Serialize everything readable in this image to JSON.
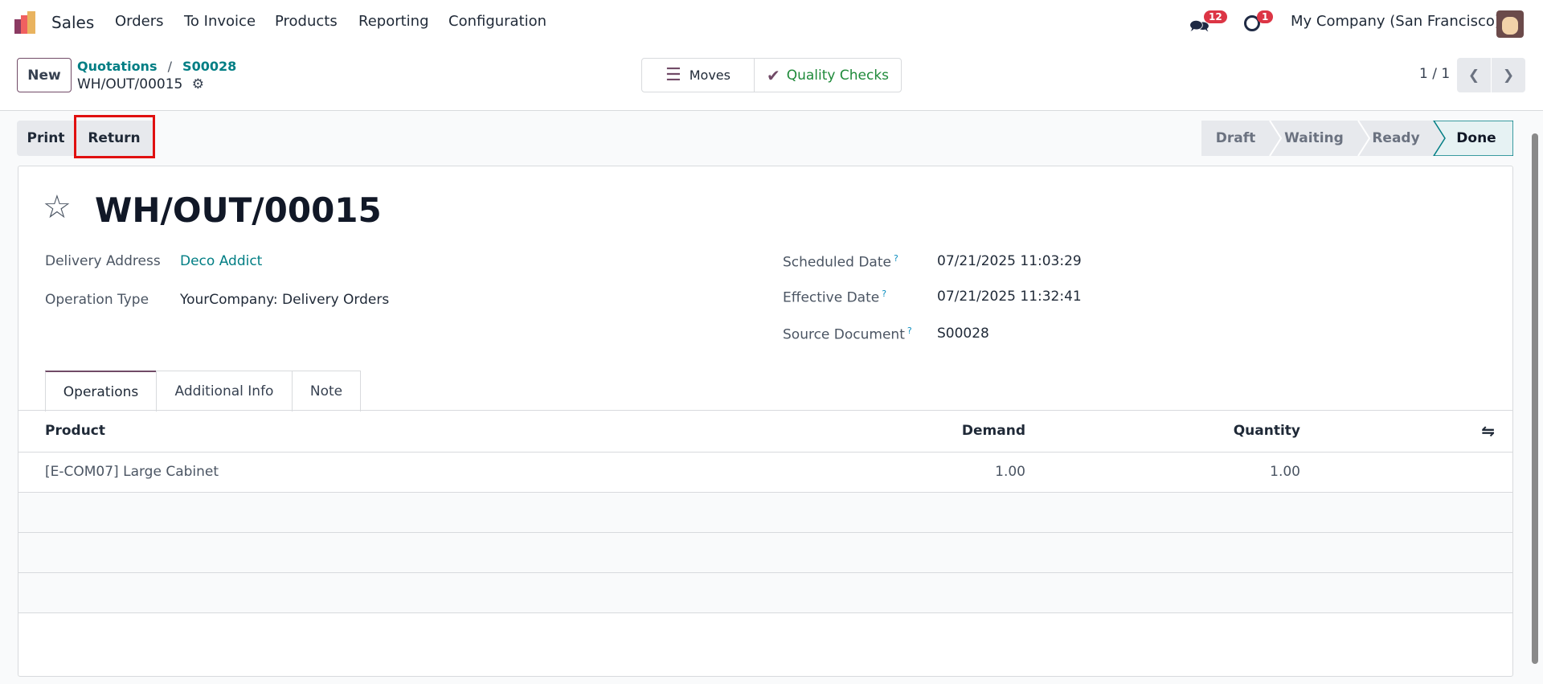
{
  "nav": {
    "app": "Sales",
    "items": [
      "Orders",
      "To Invoice",
      "Products",
      "Reporting",
      "Configuration"
    ],
    "messages_count": "12",
    "activities_count": "1",
    "company": "My Company (San Francisco)"
  },
  "control": {
    "new_label": "New",
    "breadcrumb": [
      "Quotations",
      "S00028"
    ],
    "record": "WH/OUT/00015",
    "moves_label": "Moves",
    "quality_label": "Quality Checks",
    "pager": "1 / 1"
  },
  "actions": {
    "print_label": "Print",
    "return_label": "Return"
  },
  "status": {
    "stages": [
      "Draft",
      "Waiting",
      "Ready",
      "Done"
    ],
    "current": "Done"
  },
  "form": {
    "title": "WH/OUT/00015",
    "left": [
      {
        "label": "Delivery Address",
        "value": "Deco Addict"
      },
      {
        "label": "Operation Type",
        "value": "YourCompany: Delivery Orders"
      }
    ],
    "right": [
      {
        "label": "Scheduled Date",
        "value": "07/21/2025 11:03:29"
      },
      {
        "label": "Effective Date",
        "value": "07/21/2025 11:32:41"
      },
      {
        "label": "Source Document",
        "value": "S00028"
      }
    ],
    "help_mark": "?",
    "tabs": [
      "Operations",
      "Additional Info",
      "Note"
    ],
    "table": {
      "headers": [
        "Product",
        "Demand",
        "Quantity"
      ],
      "rows": [
        {
          "product": "[E-COM07] Large Cabinet",
          "demand": "1.00",
          "quantity": "1.00"
        }
      ]
    }
  },
  "colors": {
    "accent": "#714b67",
    "link": "#017e84",
    "badge": "#dc3545",
    "done_bg": "#e6f2f3"
  }
}
